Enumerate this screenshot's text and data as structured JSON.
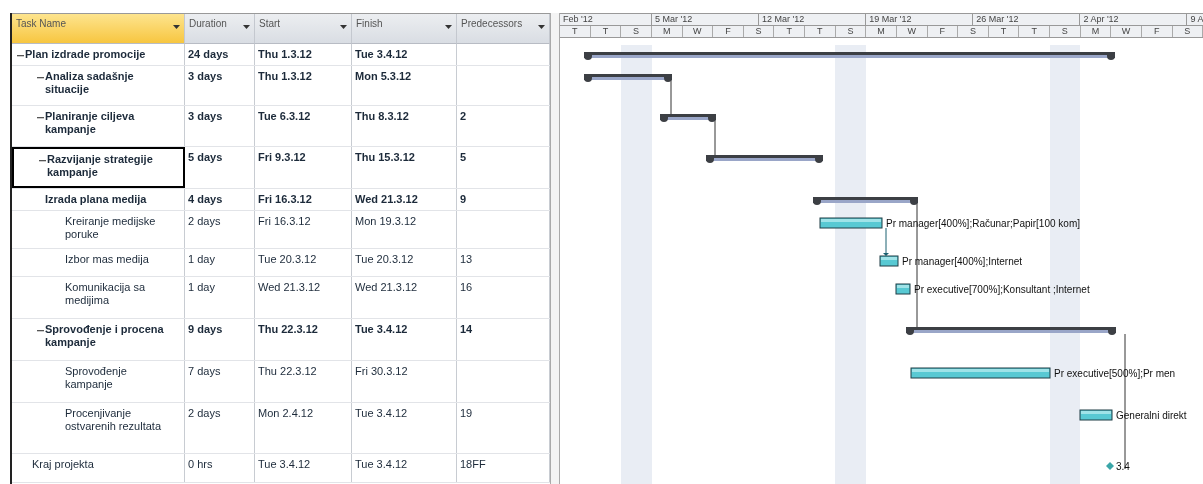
{
  "columns": [
    {
      "label": "Task Name",
      "selected": true
    },
    {
      "label": "Duration",
      "selected": false
    },
    {
      "label": "Start",
      "selected": false
    },
    {
      "label": "Finish",
      "selected": false
    },
    {
      "label": "Predecessors",
      "selected": false
    }
  ],
  "timescale": {
    "top": [
      "Feb '12",
      "5 Mar '12",
      "12 Mar '12",
      "19 Mar '12",
      "26 Mar '12",
      "2 Apr '12",
      "9 A"
    ],
    "bottom": [
      "T",
      "T",
      "S",
      "M",
      "W",
      "F",
      "S",
      "T",
      "T",
      "S",
      "M",
      "W",
      "F",
      "S",
      "T",
      "T",
      "S",
      "M",
      "W",
      "F",
      "S"
    ]
  },
  "tasks": [
    {
      "name": "Plan izdrade promocije",
      "duration": "24 days",
      "start": "Thu 1.3.12",
      "finish": "Tue 3.4.12",
      "kind": "summary",
      "expanded": true,
      "selected": false,
      "children": [
        {
          "name": "Analiza sadašnje situacije",
          "duration": "3 days",
          "start": "Thu 1.3.12",
          "finish": "Mon 5.3.12",
          "kind": "summary",
          "expanded": true,
          "selected": false
        },
        {
          "name": "Planiranje ciljeva kampanje",
          "duration": "3 days",
          "start": "Tue 6.3.12",
          "finish": "Thu 8.3.12",
          "predecessors": "2",
          "kind": "summary",
          "expanded": true,
          "selected": false
        },
        {
          "name": "Razvijanje strategije kampanje",
          "duration": "5 days",
          "start": "Fri 9.3.12",
          "finish": "Thu 15.3.12",
          "predecessors": "5",
          "kind": "summary",
          "expanded": true,
          "selected": true
        },
        {
          "name": "Izrada plana medija",
          "duration": "4 days",
          "start": "Fri 16.3.12",
          "finish": "Wed 21.3.12",
          "predecessors": "9",
          "kind": "summary",
          "selected": false,
          "children": [
            {
              "name": "Kreiranje medijske poruke",
              "duration": "2 days",
              "start": "Fri 16.3.12",
              "finish": "Mon 19.3.12",
              "kind": "task",
              "selected": false,
              "bar_label": "Pr manager[400%];Računar;Papir[100 kom]"
            },
            {
              "name": "Izbor mas medija",
              "duration": "1 day",
              "start": "Tue 20.3.12",
              "finish": "Tue 20.3.12",
              "predecessors": "13",
              "kind": "task",
              "selected": false,
              "bar_label": "Pr manager[400%];Internet"
            },
            {
              "name": "Komunikacija sa medijima",
              "duration": "1 day",
              "start": "Wed 21.3.12",
              "finish": "Wed 21.3.12",
              "predecessors": "16",
              "kind": "task",
              "selected": false,
              "bar_label": "Pr executive[700%];Konsultant ;Internet"
            }
          ]
        },
        {
          "name": "Sprovođenje i procena kampanje",
          "duration": "9 days",
          "start": "Thu 22.3.12",
          "finish": "Tue 3.4.12",
          "predecessors": "14",
          "kind": "summary",
          "expanded": true,
          "selected": false,
          "children": [
            {
              "name": "Sprovođenje kampanje",
              "duration": "7 days",
              "start": "Thu 22.3.12",
              "finish": "Fri 30.3.12",
              "kind": "task",
              "selected": false,
              "bar_label": "Pr executive[500%];Pr men"
            },
            {
              "name": "Procenjivanje ostvarenih rezultata",
              "duration": "2 days",
              "start": "Mon 2.4.12",
              "finish": "Tue 3.4.12",
              "predecessors": "19",
              "kind": "task",
              "selected": false,
              "bar_label": "Generalni direkt"
            }
          ]
        }
      ]
    },
    {
      "name": "Kraj projekta",
      "duration": "0 hrs",
      "start": "Tue 3.4.12",
      "finish": "Tue 3.4.12",
      "predecessors": "18FF",
      "kind": "milestone",
      "selected": false,
      "bar_label": "3.4"
    }
  ]
}
